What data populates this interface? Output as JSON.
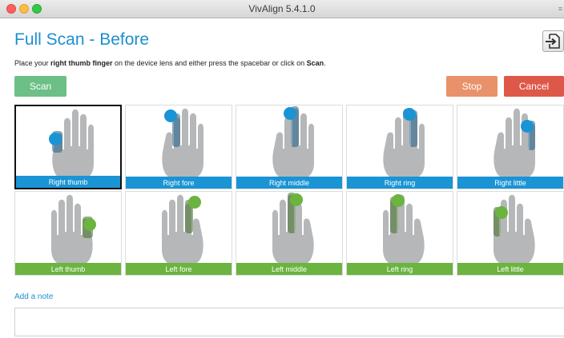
{
  "window": {
    "title": "VivAlign 5.4.1.0",
    "corner_mark": "≡"
  },
  "page": {
    "title": "Full Scan - Before",
    "instruction_parts": [
      "Place your ",
      "right thumb finger",
      " on the device lens and either press the spacebar or click on ",
      "Scan",
      "."
    ]
  },
  "buttons": {
    "scan": "Scan",
    "stop": "Stop",
    "cancel": "Cancel"
  },
  "fingers": [
    {
      "label": "Right thumb",
      "hand": "right",
      "finger": "thumb",
      "selected": true
    },
    {
      "label": "Right fore",
      "hand": "right",
      "finger": "fore",
      "selected": false
    },
    {
      "label": "Right middle",
      "hand": "right",
      "finger": "middle",
      "selected": false
    },
    {
      "label": "Right ring",
      "hand": "right",
      "finger": "ring",
      "selected": false
    },
    {
      "label": "Right little",
      "hand": "right",
      "finger": "little",
      "selected": false
    },
    {
      "label": "Left thumb",
      "hand": "left",
      "finger": "thumb",
      "selected": false
    },
    {
      "label": "Left fore",
      "hand": "left",
      "finger": "fore",
      "selected": false
    },
    {
      "label": "Left middle",
      "hand": "left",
      "finger": "middle",
      "selected": false
    },
    {
      "label": "Left ring",
      "hand": "left",
      "finger": "ring",
      "selected": false
    },
    {
      "label": "Left little",
      "hand": "left",
      "finger": "little",
      "selected": false
    }
  ],
  "note": {
    "label": "Add a note",
    "value": ""
  },
  "colors": {
    "accent": "#1e8fd0",
    "right_hand": "#1a94d4",
    "left_hand": "#6bb43f",
    "scan": "#6cbf86",
    "stop": "#e9916a",
    "cancel": "#de5849",
    "hand_fill": "#b5b7b9"
  }
}
